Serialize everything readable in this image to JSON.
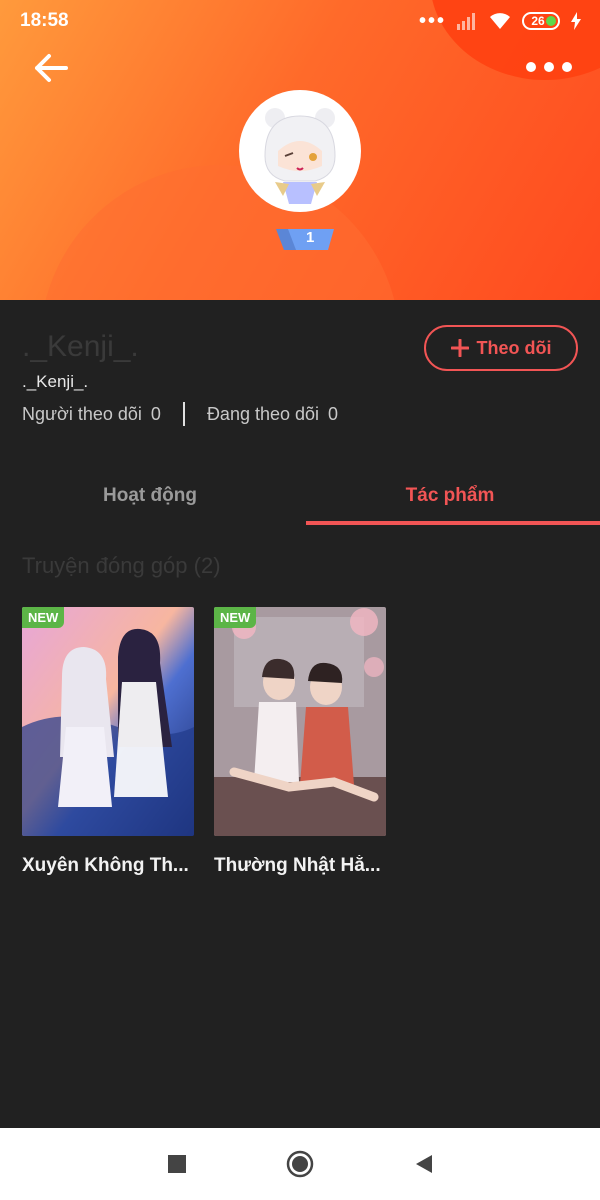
{
  "status_bar": {
    "time": "18:58",
    "battery_level": "26",
    "icons": [
      "signal-dots-icon",
      "signal-bars-icon",
      "wifi-icon",
      "battery-icon",
      "charging-icon"
    ]
  },
  "header": {
    "back_icon": "arrow-left-icon",
    "more_icon": "more-horizontal-icon",
    "level_badge": "1"
  },
  "profile": {
    "display_name": "._Kenji_.",
    "username": "._Kenji_.",
    "followers_label": "Người theo dõi",
    "followers_count": "0",
    "following_label": "Đang theo dõi",
    "following_count": "0",
    "follow_button": {
      "icon": "plus-icon",
      "label": "Theo dõi"
    }
  },
  "tabs": [
    {
      "label": "Hoạt động",
      "active": false
    },
    {
      "label": "Tác phẩm",
      "active": true
    }
  ],
  "section": {
    "title": "Truyện đóng góp (2)"
  },
  "works": [
    {
      "badge": "NEW",
      "title": "Xuyên Không Th..."
    },
    {
      "badge": "NEW",
      "title": "Thường Nhật Hằ..."
    }
  ],
  "nav_bar": {
    "icons": [
      "recents-square-icon",
      "home-circle-icon",
      "back-triangle-icon"
    ]
  },
  "colors": {
    "accent": "#f25555",
    "header_orange": "#ff6a2a",
    "background": "#212121",
    "new_badge": "#5cb547"
  }
}
